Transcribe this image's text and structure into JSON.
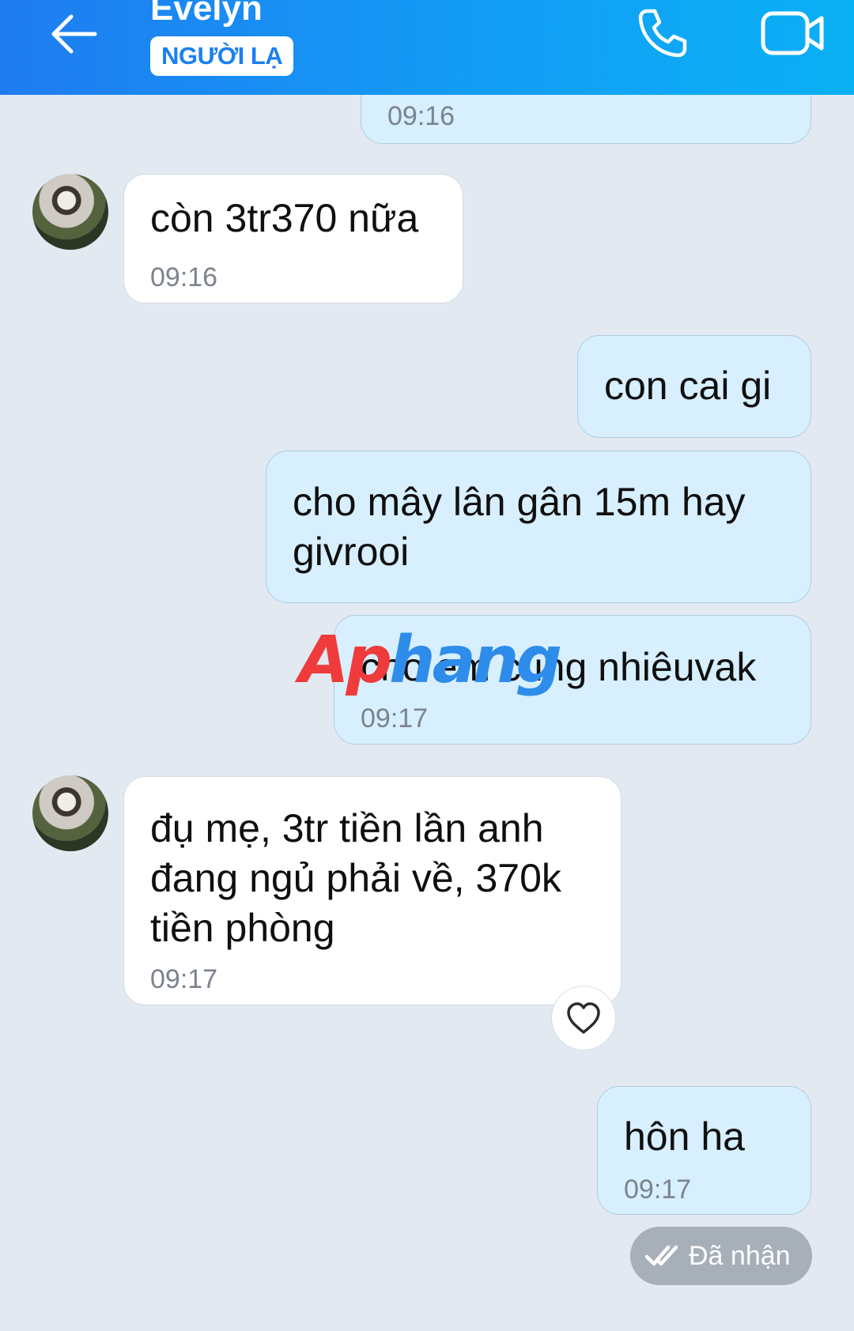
{
  "header": {
    "contact_name": "Evelyn",
    "badge": "NGƯỜI LẠ",
    "back_icon": "arrow-left-icon",
    "call_icon": "phone-icon",
    "video_icon": "video-camera-icon",
    "background": "#1a8ff3"
  },
  "messages": [
    {
      "direction": "out",
      "lines": [],
      "time": "09:16"
    },
    {
      "direction": "in",
      "lines": [
        "còn 3tr370 nữa"
      ],
      "time": "09:16"
    },
    {
      "direction": "out",
      "lines": [
        "con cai gi"
      ],
      "time": ""
    },
    {
      "direction": "out",
      "lines": [
        "cho mây lân gân 15m hay",
        "givrooi"
      ],
      "time": ""
    },
    {
      "direction": "out",
      "lines": [
        "cho em cung nhiêuvak"
      ],
      "time": "09:17"
    },
    {
      "direction": "in",
      "lines": [
        "đụ mẹ, 3tr tiền lần anh",
        "đang ngủ phải về, 370k",
        "tiền phòng"
      ],
      "time": "09:17"
    },
    {
      "direction": "out",
      "lines": [
        "hôn ha"
      ],
      "time": "09:17"
    }
  ],
  "reaction_icon": "heart-outline-icon",
  "status": {
    "label": "Đã nhận",
    "icon": "double-check-icon"
  },
  "watermark": {
    "part1": "Ap",
    "part2": "hang"
  },
  "colors": {
    "outgoing_bubble": "#d7efff",
    "incoming_bubble": "#ffffff",
    "chat_background": "#e2e9f1",
    "status_pill": "#a7afb8"
  }
}
